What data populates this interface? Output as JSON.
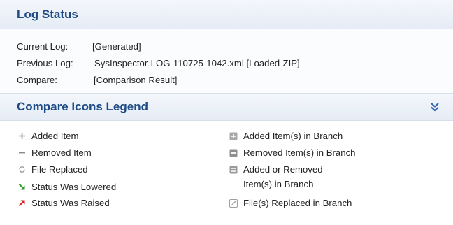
{
  "log_status": {
    "title": "Log Status",
    "current_log_label": "Current Log:",
    "current_log_value": "[Generated]",
    "previous_log_label": "Previous Log:",
    "previous_log_value": "SysInspector-LOG-110725-1042.xml [Loaded-ZIP]",
    "compare_label": "Compare:",
    "compare_value": "[Comparison Result]"
  },
  "legend": {
    "title": "Compare Icons Legend",
    "collapse_icon": "double-chevron-down-icon",
    "left_items": [
      {
        "icon": "plus-icon",
        "label": "Added Item"
      },
      {
        "icon": "minus-icon",
        "label": "Removed Item"
      },
      {
        "icon": "replace-icon",
        "label": "File Replaced"
      },
      {
        "icon": "arrow-down-green-icon",
        "label": "Status Was Lowered"
      },
      {
        "icon": "arrow-up-red-icon",
        "label": "Status Was Raised"
      }
    ],
    "right_items": [
      {
        "icon": "branch-plus-icon",
        "label": "Added Item(s) in Branch"
      },
      {
        "icon": "branch-minus-icon",
        "label": "Removed Item(s) in Branch"
      },
      {
        "icon": "branch-plusminus-icon",
        "label": "Added or Removed",
        "label2": "Item(s) in Branch"
      },
      {
        "icon": "branch-replace-icon",
        "label": "File(s) Replaced in Branch"
      }
    ]
  },
  "colors": {
    "header_text": "#1e4b86",
    "lowered_arrow": "#2a9d2a",
    "raised_arrow": "#d42020",
    "icon_gray": "#8a8a8a"
  }
}
